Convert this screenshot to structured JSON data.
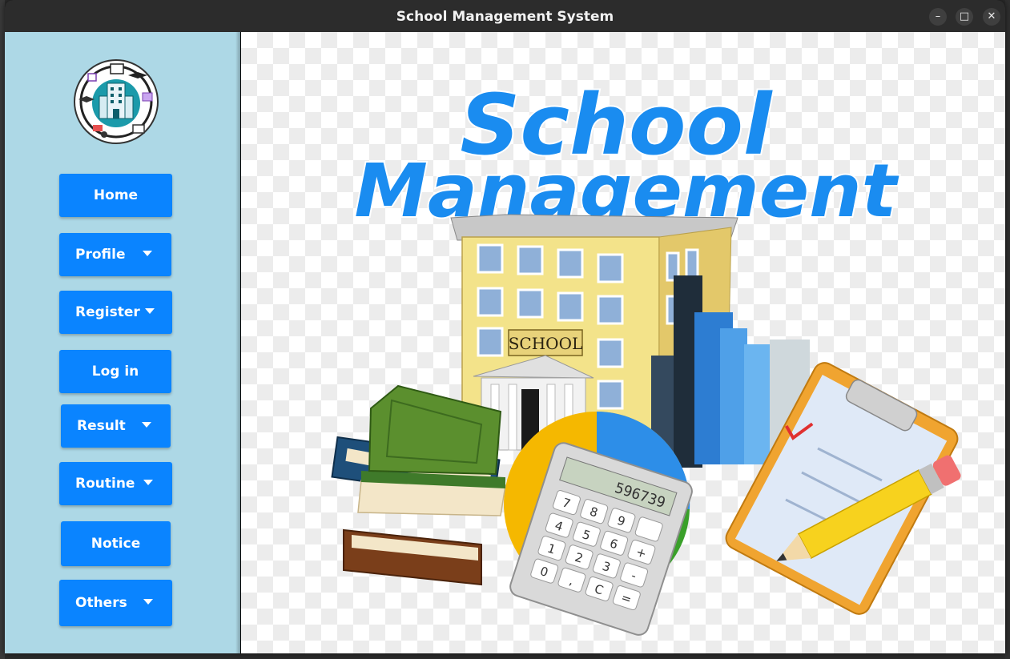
{
  "window": {
    "title": "School Management System",
    "controls": {
      "minimize": "–",
      "maximize": "□",
      "close": "✕"
    }
  },
  "sidebar": {
    "logo_icon": "school-building-logo-icon",
    "items": [
      {
        "label": "Home",
        "dropdown": false
      },
      {
        "label": "Profile",
        "dropdown": true
      },
      {
        "label": "Register",
        "dropdown": true
      },
      {
        "label": "Log in",
        "dropdown": false
      },
      {
        "label": "Result",
        "dropdown": true
      },
      {
        "label": "Routine",
        "dropdown": true
      },
      {
        "label": "Notice",
        "dropdown": false
      },
      {
        "label": "Others",
        "dropdown": true
      }
    ]
  },
  "main": {
    "banner_line1": "School",
    "banner_line2": "Management",
    "building_sign": "SCHOOL",
    "calculator_display": "596739",
    "calculator_keys": [
      "7",
      "8",
      "9",
      "4",
      "5",
      "6",
      "1",
      "2",
      "3",
      "0",
      ",",
      "C",
      "+",
      "-",
      "="
    ]
  },
  "colors": {
    "sidebar_bg": "#add8e6",
    "button_bg": "#0a84ff",
    "button_text": "#ffffff",
    "banner_text": "#1a8cf0",
    "titlebar_bg": "#2c2c2c"
  }
}
